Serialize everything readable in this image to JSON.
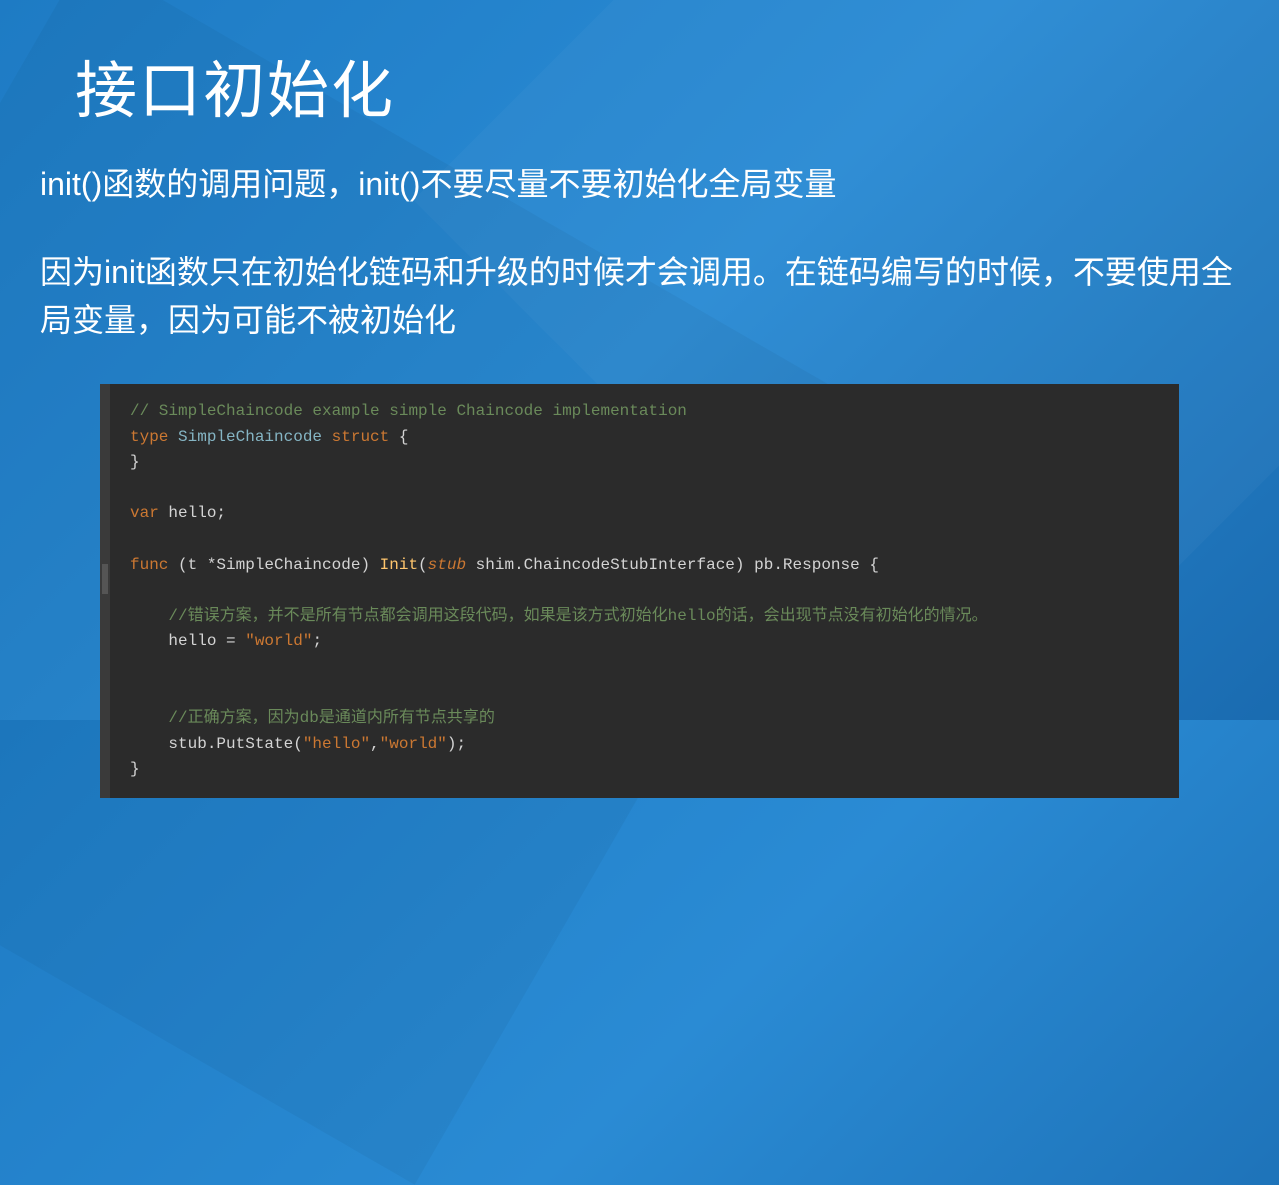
{
  "title": "接口初始化",
  "subtitle": "init()函数的调用问题，init()不要尽量不要初始化全局变量",
  "paragraph": "因为init函数只在初始化链码和升级的时候才会调用。在链码编写的时候，不要使用全局变量，因为可能不被初始化",
  "code": {
    "line1": "// SimpleChaincode example simple Chaincode implementation",
    "line2_type": "type",
    "line2_name": " SimpleChaincode ",
    "line2_struct": "struct",
    "line2_brace": " {",
    "line3": "}",
    "line4_var": "var",
    "line4_hello": " hello;",
    "line5_func": "func",
    "line5_recv": " (t *SimpleChaincode) ",
    "line5_init": "Init",
    "line5_open": "(",
    "line5_stub": "stub",
    "line5_type": " shim.ChaincodeStubInterface) pb.Response {",
    "line6": "//错误方案，并不是所有节点都会调用这段代码，如果是该方式初始化hello的话，会出现节点没有初始化的情况。",
    "line7_hello": "hello = ",
    "line7_str": "\"world\"",
    "line7_semi": ";",
    "line8": "//正确方案，因为db是通道内所有节点共享的",
    "line9_stub": "stub.PutState(",
    "line9_s1": "\"hello\"",
    "line9_c": ",",
    "line9_s2": "\"world\"",
    "line9_end": ");",
    "line10": "}"
  }
}
